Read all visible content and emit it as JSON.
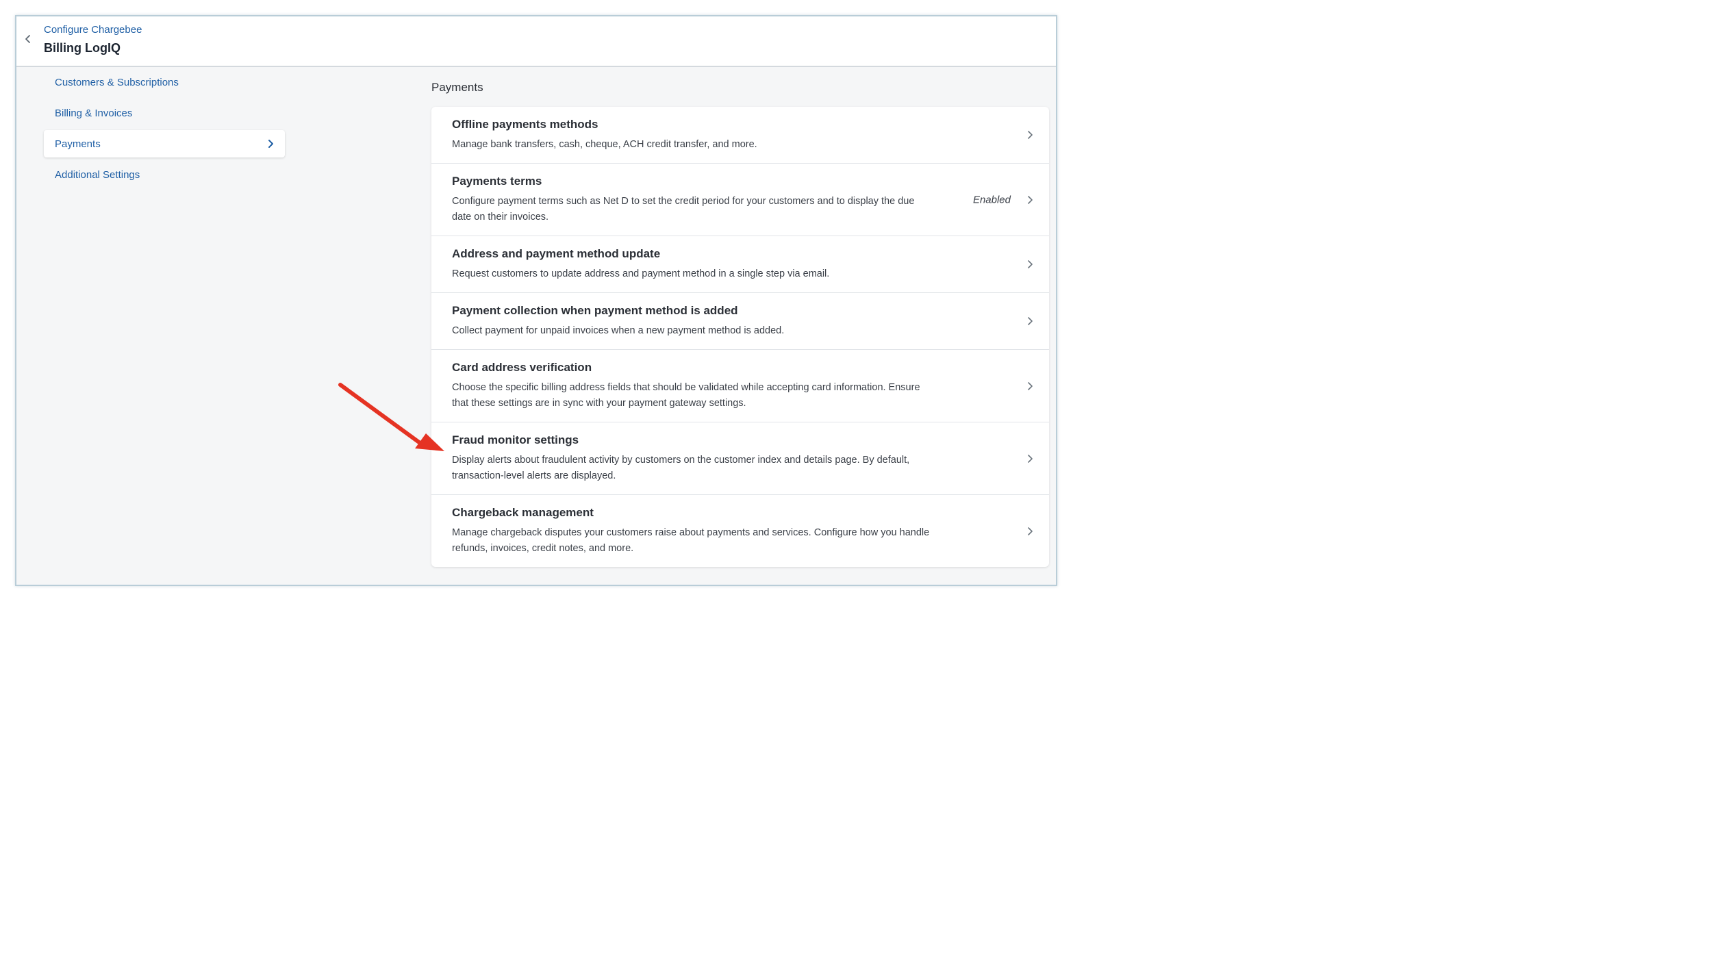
{
  "header": {
    "breadcrumb": "Configure Chargebee",
    "title": "Billing LogIQ"
  },
  "sidebar": {
    "items": [
      {
        "label": "Customers & Subscriptions"
      },
      {
        "label": "Billing & Invoices"
      },
      {
        "label": "Payments"
      },
      {
        "label": "Additional Settings"
      }
    ],
    "active_index": 2
  },
  "main": {
    "section_title": "Payments",
    "settings": [
      {
        "title": "Offline payments methods",
        "description": "Manage bank transfers, cash, cheque, ACH credit transfer, and more.",
        "status": ""
      },
      {
        "title": "Payments terms",
        "description": "Configure payment terms such as Net D to set the credit period for your customers and to display the due date on their invoices.",
        "status": "Enabled"
      },
      {
        "title": "Address and payment method update",
        "description": "Request customers to update address and payment method in a single step via email.",
        "status": ""
      },
      {
        "title": "Payment collection when payment method is added",
        "description": "Collect payment for unpaid invoices when a new payment method is added.",
        "status": ""
      },
      {
        "title": "Card address verification",
        "description": "Choose the specific billing address fields that should be validated while accepting card information. Ensure that these settings are in sync with your payment gateway settings.",
        "status": ""
      },
      {
        "title": "Fraud monitor settings",
        "description": "Display alerts about fraudulent activity by customers on the customer index and details page. By default, transaction-level alerts are displayed.",
        "status": ""
      },
      {
        "title": "Chargeback management",
        "description": "Manage chargeback disputes your customers raise about payments and services. Configure how you handle refunds, invoices, credit notes, and more.",
        "status": ""
      }
    ]
  },
  "icons": {
    "back": "chevron-left-icon",
    "row": "chevron-right-icon",
    "annotation": "red-arrow-annotation"
  },
  "colors": {
    "link": "#1f5fa5",
    "annotation": "#e53323",
    "background": "#f5f6f7"
  }
}
